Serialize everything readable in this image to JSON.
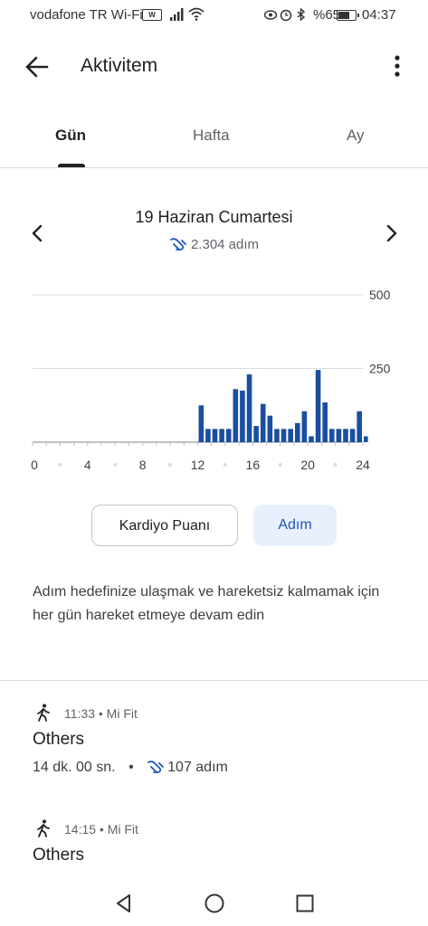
{
  "status_bar": {
    "carrier": "vodafone TR Wi-Fi",
    "volte": "VoWiFi",
    "battery": "%65",
    "time": "04:37"
  },
  "app_bar": {
    "title": "Aktivitem",
    "back_icon": "arrow-left-icon",
    "more_icon": "more-vert-icon"
  },
  "tabs": [
    {
      "label": "Gün",
      "selected": true
    },
    {
      "label": "Hafta",
      "selected": false
    },
    {
      "label": "Ay",
      "selected": false
    }
  ],
  "date_header": {
    "date": "19 Haziran Cumartesi",
    "steps_summary": "2.304 adım"
  },
  "chart_data": {
    "type": "bar",
    "x": [
      0,
      0.5,
      1,
      1.5,
      2,
      2.5,
      3,
      3.5,
      4,
      4.5,
      5,
      5.5,
      6,
      6.5,
      7,
      7.5,
      8,
      8.5,
      9,
      9.5,
      10,
      10.5,
      11,
      11.5,
      12,
      12.5,
      13,
      13.5,
      14,
      14.5,
      15,
      15.5,
      16,
      16.5,
      17,
      17.5,
      18,
      18.5,
      19,
      19.5,
      20,
      20.5,
      21,
      21.5,
      22,
      22.5,
      23,
      23.5
    ],
    "values": [
      0,
      0,
      0,
      0,
      0,
      0,
      0,
      0,
      0,
      0,
      0,
      0,
      0,
      0,
      0,
      0,
      0,
      0,
      0,
      0,
      0,
      0,
      0,
      0,
      125,
      45,
      45,
      45,
      45,
      180,
      175,
      230,
      55,
      130,
      90,
      45,
      45,
      45,
      65,
      105,
      20,
      245,
      135,
      45,
      45,
      45,
      45,
      105
    ],
    "values_tail": 20,
    "yticks": [
      250,
      500
    ],
    "ylim": [
      0,
      500
    ],
    "xticks": [
      "0",
      "4",
      "8",
      "12",
      "16",
      "20",
      "24"
    ],
    "xlim": [
      0,
      24
    ],
    "bar_color": "#1a4fa0",
    "grid": true
  },
  "metric_buttons": {
    "cardio": "Kardiyo Puanı",
    "steps": "Adım"
  },
  "info_text": "Adım hedefinize ulaşmak ve hareketsiz kalmamak için her gün hareket etmeye devam edin",
  "activities": [
    {
      "meta": "11:33 • Mi Fit",
      "title": "Others",
      "duration": "14 dk. 00 sn.",
      "separator": "•",
      "steps": "107 adım",
      "icon": "walking-person-icon"
    },
    {
      "meta": "14:15 • Mi Fit",
      "title": "Others",
      "duration": "",
      "separator": "",
      "steps": "",
      "icon": "walking-person-icon"
    }
  ],
  "colors": {
    "accent": "#1a56b8",
    "selected_button_bg": "#e8f0fe"
  }
}
